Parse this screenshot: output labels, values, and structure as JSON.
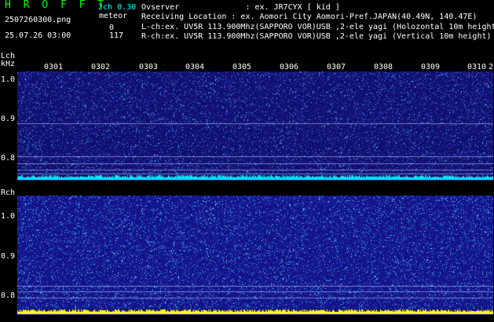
{
  "header": {
    "title": "H R O F F T",
    "channel_info": "2ch 0.30",
    "filename": "2507260300.png",
    "datetime": "25.07.26 03:00",
    "meteor_label": "meteor",
    "meteor_counts": [
      "0",
      "117"
    ],
    "observer_line": "Ovserver              : ex. JR7CYX [ kid ]",
    "location_line": "Receiving Location : ex. Aomori City Aomori-Pref.JAPAN(40.49N, 140.47E)",
    "lch_line": "L-ch:ex. UV5R 113.900Mhz(SAPPORO VOR)USB ,2-ele yagi (Holozontal 10m height)",
    "rch_line": "R-ch:ex. UV5R 113.900Mhz(SAPPORO VOR)USB ,2-ele yagi (Vertical 10m height)"
  },
  "lch": {
    "label": "Lch",
    "unit": "kHz",
    "time_ticks": [
      "0301",
      "0302",
      "0303",
      "0304",
      "0305",
      "0306",
      "0307",
      "0308",
      "0309",
      "0310"
    ],
    "trailing_tick": "2",
    "y_ticks": [
      "1.0",
      "0.9",
      "0.8"
    ]
  },
  "rch": {
    "label": "Rch",
    "y_ticks": [
      "1.0",
      "0.9",
      "0.8"
    ]
  },
  "colors": {
    "noise_dark": "#1a1a8c",
    "noise_light": "#4fd0ff",
    "baseline_cyan": "#00e5ff",
    "baseline_yellow": "#ffff00",
    "accent_green": "#00ff00"
  }
}
